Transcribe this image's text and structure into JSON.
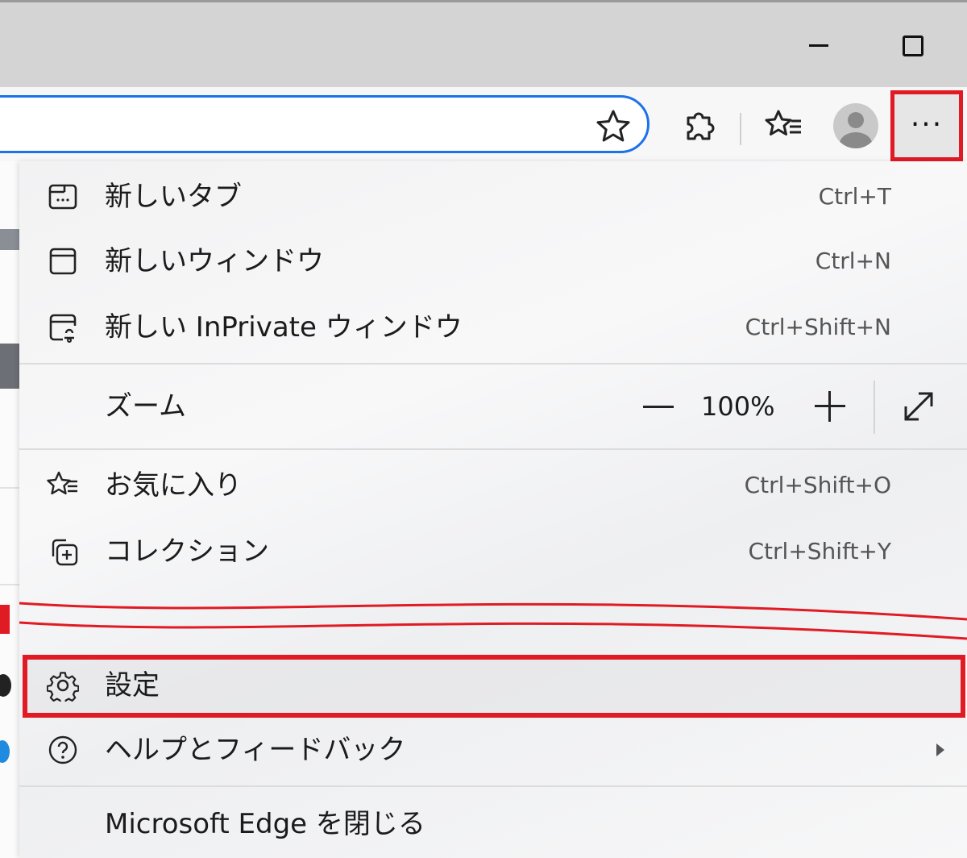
{
  "window": {
    "minimize_label": "—",
    "maximize_label": "☐"
  },
  "toolbar": {
    "address_value": "",
    "icons": [
      "star-icon",
      "extensions-icon",
      "favorites-icon",
      "profile-icon",
      "more-icon"
    ],
    "more_label": "···"
  },
  "menu": {
    "items": [
      {
        "label": "新しいタブ",
        "shortcut": "Ctrl+T",
        "icon": "new-tab-icon"
      },
      {
        "label": "新しいウィンドウ",
        "shortcut": "Ctrl+N",
        "icon": "new-window-icon"
      },
      {
        "label": "新しい InPrivate ウィンドウ",
        "shortcut": "Ctrl+Shift+N",
        "icon": "inprivate-icon"
      }
    ],
    "zoom": {
      "label": "ズーム",
      "level": "100%",
      "minus": "—",
      "plus": "+"
    },
    "items2": [
      {
        "label": "お気に入り",
        "shortcut": "Ctrl+Shift+O",
        "icon": "favorites-icon"
      },
      {
        "label": "コレクション",
        "shortcut": "Ctrl+Shift+Y",
        "icon": "collections-icon"
      }
    ],
    "settings": {
      "label": "設定",
      "icon": "gear-icon"
    },
    "help": {
      "label": "ヘルプとフィードバック",
      "icon": "help-icon"
    },
    "close": {
      "label": "Microsoft Edge を閉じる"
    }
  },
  "colors": {
    "highlight": "#e01b24",
    "address_border": "#1a73e8"
  }
}
